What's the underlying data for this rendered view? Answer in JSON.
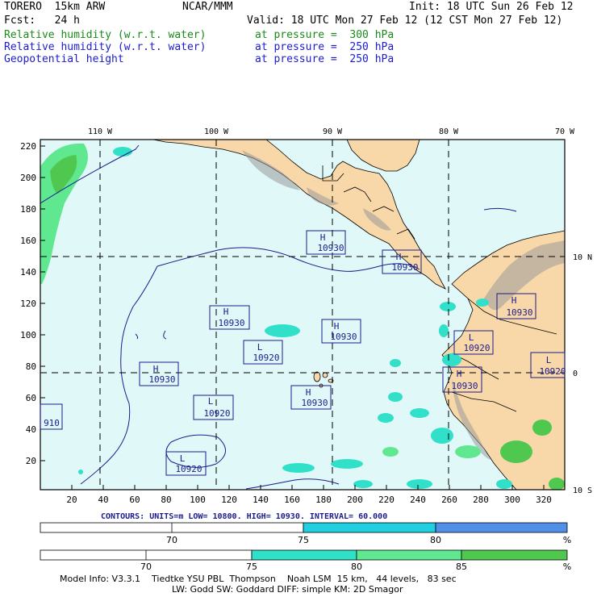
{
  "header": {
    "model_name": "TORERO  15km ARW",
    "org": "NCAR/MMM",
    "init": "Init: 18 UTC Sun 26 Feb 12",
    "fcst": "Fcst:   24 h",
    "valid": "Valid: 18 UTC Mon 27 Feb 12 (12 CST Mon 27 Feb 12)",
    "fields": [
      {
        "name": "Relative humidity (w.r.t. water)",
        "level": "at pressure =  300 hPa",
        "color": "#1a8a1a"
      },
      {
        "name": "Relative humidity (w.r.t. water)",
        "level": "at pressure =  250 hPa",
        "color": "#1c1ccc"
      },
      {
        "name": "Geopotential height",
        "level": "at pressure =  250 hPa",
        "color": "#1c1ccc"
      }
    ]
  },
  "map": {
    "top_lon_labels": [
      "110 W",
      "100 W",
      "90 W",
      "80 W",
      "70 W"
    ],
    "right_lat_labels": [
      "10 N",
      "0",
      "10 S"
    ],
    "y_ticks": [
      "220",
      "200",
      "180",
      "160",
      "140",
      "120",
      "100",
      "80",
      "60",
      "40",
      "20"
    ],
    "x_ticks": [
      "20",
      "40",
      "60",
      "80",
      "100",
      "120",
      "140",
      "160",
      "180",
      "200",
      "220",
      "240",
      "260",
      "280",
      "300",
      "320"
    ],
    "centers": [
      {
        "type": "H",
        "value": "10930"
      },
      {
        "type": "H",
        "value": "10930"
      },
      {
        "type": "H",
        "value": "10930"
      },
      {
        "type": "H",
        "value": "10930"
      },
      {
        "type": "L",
        "value": "10920"
      },
      {
        "type": "H",
        "value": "10930"
      },
      {
        "type": "H",
        "value": "10930"
      },
      {
        "type": "L",
        "value": "10920"
      },
      {
        "type": "L",
        "value": "10920"
      },
      {
        "type": "H",
        "value": "10930"
      },
      {
        "type": "L",
        "value": "10920"
      },
      {
        "type": "L",
        "value": "10920"
      },
      {
        "type": "",
        "value": "910"
      }
    ],
    "colors": {
      "ocean": "#e0f8f8",
      "land": "#f8d8a8",
      "contour": "#1c1c8c",
      "rh_light": "#40e8c8",
      "rh_mid": "#60d890",
      "rh_dark": "#50c850"
    }
  },
  "contour_info": "CONTOURS:  UNITS=m  LOW=  10800.         HIGH=  10930.         INTERVAL=   60.000",
  "colorbar_1": {
    "ticks": [
      "70",
      "75",
      "80"
    ],
    "unit": "%",
    "colors": [
      "#ffffff",
      "#20d0e0",
      "#5090e8"
    ]
  },
  "colorbar_2": {
    "ticks": [
      "70",
      "75",
      "80",
      "85"
    ],
    "unit": "%",
    "colors": [
      "#ffffff",
      "#30e0c8",
      "#60e890",
      "#50c850"
    ]
  },
  "model_info": [
    "Model Info: V3.3.1    Tiedtke YSU PBL  Thompson    Noah LSM  15 km,   44 levels,   83 sec",
    "LW: Godd SW: Goddard DIFF: simple KM: 2D Smagor"
  ]
}
